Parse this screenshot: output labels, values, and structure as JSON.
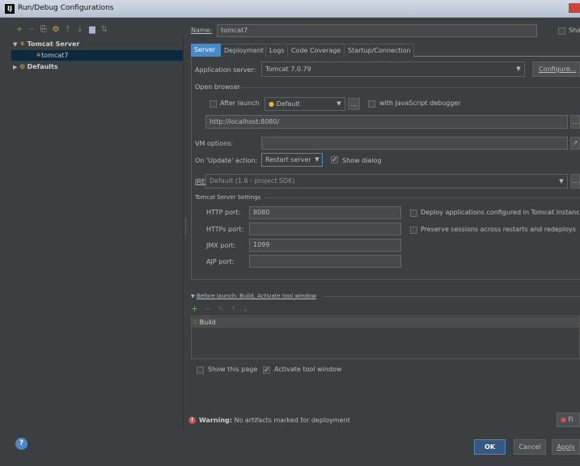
{
  "window": {
    "title": "Run/Debug Configurations",
    "app_icon": "intellij-icon"
  },
  "left_toolbar": [
    {
      "name": "add-icon",
      "glyph": "+",
      "color": "#6aa84f"
    },
    {
      "name": "remove-icon",
      "glyph": "−",
      "color": "#c75450"
    },
    {
      "name": "copy-icon",
      "glyph": "⎘",
      "color": "#a9b7c6"
    },
    {
      "name": "edit-defaults-icon",
      "glyph": "⚙",
      "color": "#d6a84b"
    },
    {
      "name": "move-up-icon",
      "glyph": "↑",
      "color": "#77797c"
    },
    {
      "name": "move-down-icon",
      "glyph": "↓",
      "color": "#77797c"
    },
    {
      "name": "folder-icon",
      "glyph": "▆",
      "color": "#a9b7c6"
    },
    {
      "name": "sort-icon",
      "glyph": "⇅",
      "color": "#77797c"
    }
  ],
  "tree": {
    "tomcat_server": "Tomcat Server",
    "tomcat7": "tomcat7",
    "defaults": "Defaults"
  },
  "name_field": {
    "label": "Name:",
    "value": "tomcat7",
    "share_label": "Sha"
  },
  "tabs": [
    "Server",
    "Deployment",
    "Logs",
    "Code Coverage",
    "Startup/Connection"
  ],
  "server": {
    "app_server_label": "Application server:",
    "app_server_value": "Tomcat 7.0.79",
    "configure_label": "Configure...",
    "open_browser_label": "Open browser",
    "after_launch_label": "After launch",
    "browser_value": "Default",
    "browse_dots": "...",
    "js_debugger_label": "with JavaScript debugger",
    "url_value": "http://localhost:8080/",
    "vm_options_label": "VM options:",
    "vm_options_value": "",
    "on_update_label": "On 'Update' action:",
    "on_update_value": "Restart server",
    "show_dialog_label": "Show dialog",
    "jre_label": "JRE:",
    "jre_value": "Default (1.6 - project SDK)",
    "tomcat_settings_label": "Tomcat Server Settings",
    "http_port_label": "HTTP port:",
    "http_port_value": "8080",
    "https_port_label": "HTTPs port:",
    "https_port_value": "",
    "jmx_port_label": "JMX port:",
    "jmx_port_value": "1099",
    "ajp_port_label": "AJP port:",
    "ajp_port_value": "",
    "deploy_apps_label": "Deploy applications configured in Tomcat instanc",
    "preserve_sessions_label": "Preserve sessions across restarts and redeploys"
  },
  "before_launch": {
    "header": "Before launch: Build, Activate tool window",
    "items": [
      "Build"
    ],
    "show_page_label": "Show this page",
    "activate_label": "Activate tool window"
  },
  "warning": {
    "bold": "Warning:",
    "text": "No artifacts marked for deployment",
    "fix_label": "Fi"
  },
  "footer": {
    "ok_label": "OK",
    "cancel_label": "Cancel",
    "apply_label": "Apply",
    "help_glyph": "?"
  },
  "colors": {
    "background": "#3c3f41",
    "accent_blue": "#4a88c7",
    "selection": "#0d293e",
    "warning_red": "#c75450",
    "add_green": "#6aa84f"
  }
}
